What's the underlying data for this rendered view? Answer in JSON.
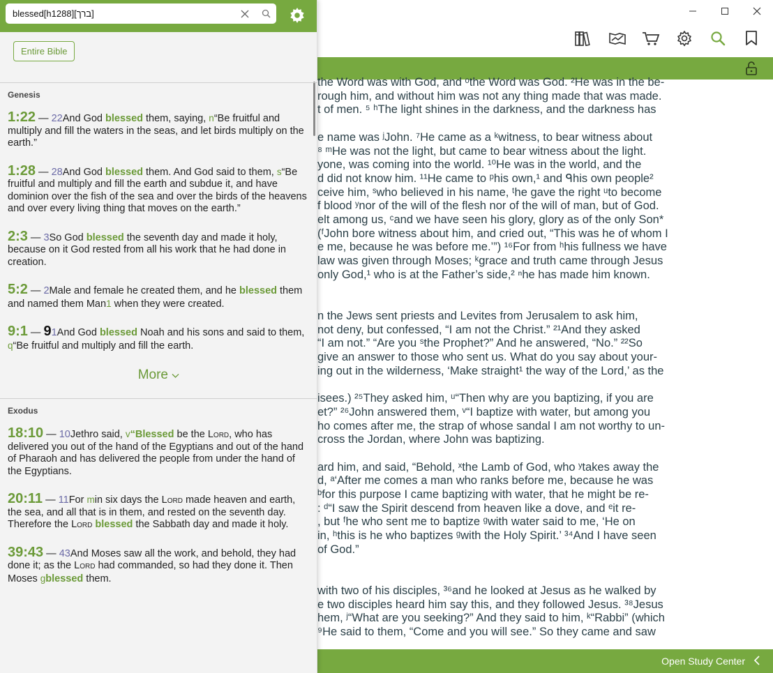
{
  "search": {
    "value": "blessed[h1288][ברך]"
  },
  "scope": {
    "label": "Entire Bible"
  },
  "results": {
    "genesis": {
      "book": "Genesis",
      "r1": {
        "ref": "1:22",
        "dash": " — ",
        "vnum": "22",
        "a": "And God ",
        "hit": "blessed",
        "b": " them, saying, ",
        "fn": "n",
        "c": "“Be fruitful and multiply and fill the waters in the seas, and let birds multiply on the earth.”"
      },
      "r2": {
        "ref": "1:28",
        "dash": " — ",
        "vnum": "28",
        "a": "And God ",
        "hit": "blessed",
        "b": " them. And God said to them, ",
        "fn": "s",
        "c": "“Be fruitful and multiply and fill the earth and subdue it, and have dominion over the fish of the sea and over the birds of the heavens and over every living thing that moves on the earth.”"
      },
      "r3": {
        "ref": "2:3",
        "dash": " — ",
        "vnum": "3",
        "a": "So God ",
        "hit": "blessed",
        "b": " the seventh day and made it holy, because on it God rested from all his work that he had done in creation."
      },
      "r4": {
        "ref": "5:2",
        "dash": " — ",
        "vnum": "2",
        "a": "Male and female he created them, and he ",
        "hit": "blessed",
        "b": " them and named them Man",
        "fn": "1",
        "c": " when they were created."
      },
      "r5": {
        "ref": "9:1",
        "dash": " — ",
        "big": "9",
        "vnum": "1",
        "a": "And God ",
        "hit": "blessed",
        "b": " Noah and his sons and said to them, ",
        "fn": "q",
        "c": "“Be fruitful and multiply and fill the earth."
      },
      "more": "More"
    },
    "exodus": {
      "book": "Exodus",
      "r1": {
        "ref": "18:10",
        "dash": " — ",
        "vnum": "10",
        "a": "Jethro said, ",
        "fn": "v",
        "hit": "“Blessed",
        "b": " be the ",
        "lord": "Lord",
        "c": ", who has delivered you out of the hand of the Egyptians and out of the hand of Pharaoh and has delivered the people from under the hand of the Egyptians."
      },
      "r2": {
        "ref": "20:11",
        "dash": " — ",
        "vnum": "11",
        "a": "For ",
        "fn": "m",
        "b": "in six days the ",
        "lord": "Lord",
        "c": " made heaven and earth, the sea, and all that is in them, and rested on the seventh day. Therefore the ",
        "lord2": "Lord",
        "hit": "blessed",
        "d": " the Sabbath day and made it holy."
      },
      "r3": {
        "ref": "39:43",
        "dash": " — ",
        "vnum": "43",
        "a": "And Moses saw all the work, and behold, they had done it; as the ",
        "lord": "Lord",
        "b": " had commanded, so had they done it. Then Moses ",
        "fn": "g",
        "hit": "blessed",
        "c": " them."
      }
    }
  },
  "reader": {
    "lines": [
      "the Word was with God, and ᵒthe Word was God. ²He was in the be-",
      "rough him, and without him was not any thing made that was made.",
      "t of men. ⁵ ʰThe light shines in the darkness, and the darkness has",
      "",
      "e name was ʲJohn. ⁷He came as a ᵏwitness, to bear witness about",
      "⁸ ᵐHe was not the light, but came to bear witness about the light.",
      "yone, was coming into the world. ¹⁰He was in the world, and the",
      "d did not know him. ¹¹He came to ᵖhis own,¹ and ᑫhis own people²",
      "ceive him, ˢwho believed in his name, ᵗhe gave the right ᵘto become",
      "f blood ʸnor of the will of the flesh nor of the will of man, but of God.",
      "elt among us, ᶜand we have seen his glory, glory as of the only Son*",
      "(ᶠJohn bore witness about him, and cried out, “This was he of whom I",
      "e me, because he was before me.’”) ¹⁶For from ʰhis fullness we have",
      "law was given through Moses; ᵏgrace and truth came through Jesus",
      "only God,¹ who is at the Father’s side,² ⁿhe has made him known.",
      "",
      "",
      "n the Jews sent priests and Levites from Jerusalem to ask him,",
      "not deny, but confessed, “I am not the Christ.” ²¹And they asked",
      "“I am not.” “Are you ˢthe Prophet?” And he answered, “No.” ²²So",
      "give an answer to those who sent us. What do you say about your-",
      "ing out in the wilderness, ‘Make straight¹ the way of the Lord,’ as the",
      "",
      "isees.) ²⁵They asked him, ᵘ“Then why are you baptizing, if you are",
      "et?” ²⁶John answered them, ᵛ“I baptize with water, but among you",
      "ho comes after me, the strap of whose sandal I am not worthy to un-",
      "cross the Jordan, where John was baptizing.",
      "",
      "ard him, and said, “Behold, ˣthe Lamb of God, who ʸtakes away the",
      "d, ᵃ‘After me comes a man who ranks before me, because he was",
      "ᵇfor this purpose I came baptizing with water, that he might be re-",
      ": ᵈ“I saw the Spirit descend from heaven like a dove, and ᵉit re-",
      ", but ᶠhe who sent me to baptize ᵍwith water said to me, ‘He on",
      "in, ʰthis is he who baptizes ᵍwith the Holy Spirit.’ ³⁴And I have seen",
      "of God.”",
      "",
      "",
      "with two of his disciples, ³⁶and he looked at Jesus as he walked by",
      "e two disciples heard him say this, and they followed Jesus. ³⁸Jesus",
      "hem, ʲ“What are you seeking?” And they said to him, ᵏ“Rabbi” (which",
      "⁹He said to them, “Come and you will see.” So they came and saw"
    ]
  },
  "study": {
    "label": "Open Study Center"
  },
  "icons": {
    "toolbar": [
      "library-icon",
      "reading-plans-icon",
      "store-icon",
      "settings-icon",
      "search-icon",
      "bookmark-icon"
    ],
    "accent": "#77a940"
  }
}
